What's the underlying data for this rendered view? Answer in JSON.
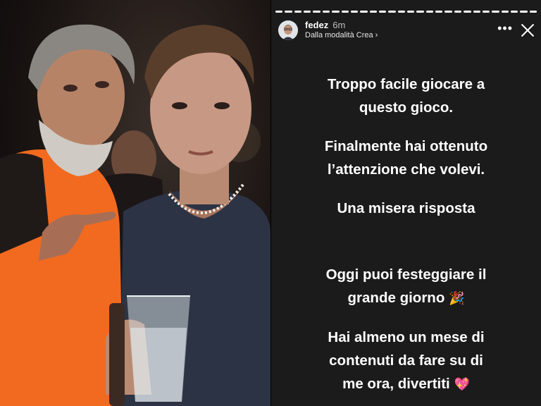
{
  "story": {
    "username": "fedez",
    "time_ago": "6m",
    "source": "Dalla modalità Crea",
    "source_chevron": "›",
    "more_icon": "ellipsis-icon",
    "close_icon": "close-icon",
    "progress_segments": 28,
    "active_segment": 28,
    "paragraphs": [
      {
        "lines": [
          "Troppo facile giocare a",
          "questo gioco."
        ]
      },
      {
        "lines": [
          "Finalmente hai ottenuto",
          "l’attenzione che volevi."
        ]
      },
      {
        "lines": [
          "Una misera risposta"
        ]
      },
      {
        "lines": [
          "Oggi puoi festeggiare il",
          "grande giorno"
        ],
        "emoji": "🎉"
      },
      {
        "lines": [
          "Hai almeno un mese di",
          "contenuti da fare su di",
          "me ora, divertiti"
        ],
        "emoji": "💖"
      }
    ]
  },
  "colors": {
    "story_bg": "#1b1b1b",
    "text": "#ffffff",
    "vest_orange": "#f26a1f"
  }
}
